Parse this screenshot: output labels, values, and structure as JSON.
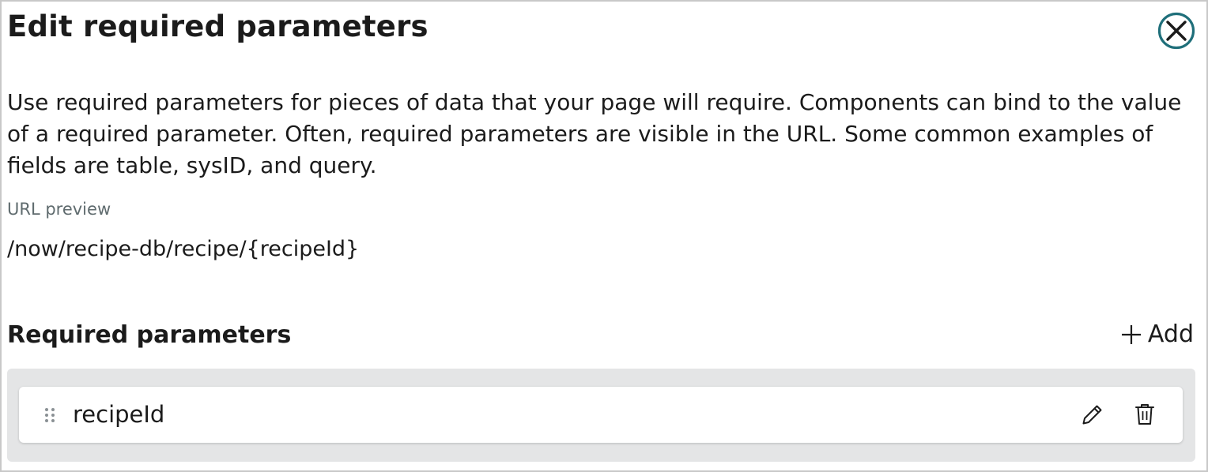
{
  "dialog": {
    "title": "Edit required parameters",
    "close_icon": "close-circle-icon",
    "description": "Use required parameters for pieces of data that your page will require. Components can bind to the value of a required parameter. Often, required parameters are visible in the URL. Some common examples of fields are table, sysID, and query.",
    "url_preview": {
      "label": "URL preview",
      "value": "/now/recipe-db/recipe/{recipeId}"
    },
    "required_parameters": {
      "heading": "Required parameters",
      "add_label": "Add",
      "add_icon": "plus-icon",
      "items": [
        {
          "name": "recipeId",
          "drag_icon": "drag-handle-icon",
          "edit_icon": "pencil-icon",
          "delete_icon": "trash-icon"
        }
      ]
    }
  },
  "colors": {
    "accent": "#1f6f7a",
    "text": "#1b1b1b",
    "muted": "#5f6b6e",
    "list_background": "#e4e5e6",
    "border": "#c8c8c8"
  }
}
